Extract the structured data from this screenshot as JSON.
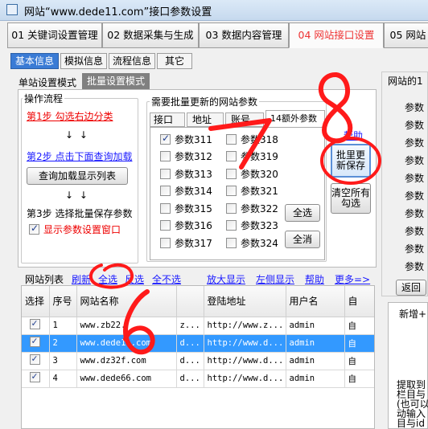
{
  "window": {
    "title": "网站“www.dede11.com”接口参数设置"
  },
  "main_tabs": [
    {
      "label": "01 关键词设置管理"
    },
    {
      "label": "02 数据采集与生成"
    },
    {
      "label": "03 数据内容管理"
    },
    {
      "label": "04 网站接口设置"
    },
    {
      "label": "05 网站"
    }
  ],
  "sub_tabs": [
    {
      "label": "基本信息"
    },
    {
      "label": "模拟信息"
    },
    {
      "label": "流程信息"
    },
    {
      "label": "其它"
    }
  ],
  "mode_tabs": [
    {
      "label": "单站设置模式"
    },
    {
      "label": "批量设置模式"
    }
  ],
  "flow": {
    "title": "操作流程",
    "step1": "第1步  勾选右边分类",
    "arrow": "↓  ↓",
    "step2": "第2步  点击下面查询加载",
    "load_button": "查询加载显示列表",
    "step3": "第3步  选择批量保存参数",
    "show_params": "显示参数设置窗口"
  },
  "params_box": {
    "title": "需要批量更新的网站参数",
    "tabs": [
      "接口",
      "地址",
      "账号",
      "14额外参数"
    ],
    "col1": [
      {
        "label": "参数311",
        "checked": true
      },
      {
        "label": "参数312",
        "checked": false
      },
      {
        "label": "参数313",
        "checked": false
      },
      {
        "label": "参数314",
        "checked": false
      },
      {
        "label": "参数315",
        "checked": false
      },
      {
        "label": "参数316",
        "checked": false
      },
      {
        "label": "参数317",
        "checked": false
      }
    ],
    "col2": [
      {
        "label": "参数318",
        "checked": false
      },
      {
        "label": "参数319",
        "checked": false
      },
      {
        "label": "参数320",
        "checked": false
      },
      {
        "label": "参数321",
        "checked": false
      },
      {
        "label": "参数322",
        "checked": false
      },
      {
        "label": "参数323",
        "checked": false
      },
      {
        "label": "参数324",
        "checked": false
      }
    ],
    "select_all": "全选",
    "cancel_all": "全消"
  },
  "side_actions": {
    "help": "帮助",
    "batch_save": "批里更新保存",
    "clear_checked": "清空所有勾选"
  },
  "list_bar": {
    "label": "网站列表",
    "refresh": "刷新",
    "select_all": "全选",
    "invert": "反选",
    "select_none": "全不选",
    "zoom": "放大显示",
    "left_show": "左侧显示",
    "help": "帮助",
    "more": "更多=>"
  },
  "table": {
    "headers": [
      "选择",
      "序号",
      "网站名称",
      "",
      "登陆地址",
      "用户名",
      "自"
    ],
    "rows": [
      {
        "checked": true,
        "num": "1",
        "name": "www.zb22.",
        "col4": "z...",
        "url": "http://www.z...",
        "user": "admin",
        "extra": "自",
        "selected": false
      },
      {
        "checked": true,
        "num": "2",
        "name": "www.dede11.com",
        "col4": "d...",
        "url": "http://www.d...",
        "user": "admin",
        "extra": "自",
        "selected": true
      },
      {
        "checked": true,
        "num": "3",
        "name": "www.dz32f.com",
        "col4": "d...",
        "url": "http://www.d...",
        "user": "admin",
        "extra": "自",
        "selected": false
      },
      {
        "checked": true,
        "num": "4",
        "name": "www.dede66.com",
        "col4": "d...",
        "url": "http://www.d...",
        "user": "admin",
        "extra": "自",
        "selected": false
      }
    ]
  },
  "right_panel": {
    "title": "网站的1",
    "labels": [
      "参数",
      "参数",
      "参数",
      "参数",
      "参数",
      "参数",
      "参数",
      "参数",
      "参数",
      "参数"
    ],
    "back": "返回",
    "note_top": "新增+",
    "note_lines": [
      "提取到",
      "栏目与",
      "(也可以",
      "动输入",
      "目与id"
    ]
  },
  "annotations": {
    "digit_8": "8",
    "digit_7": "7",
    "digit_6": "6",
    "color": "#ff1a1a"
  }
}
